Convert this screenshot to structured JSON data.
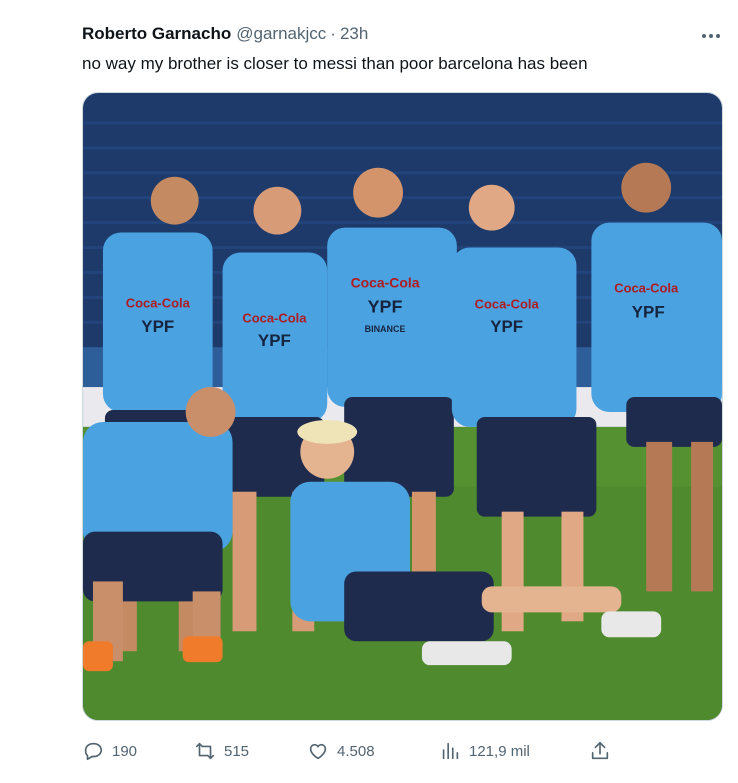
{
  "tweet": {
    "author_name": "Roberto Garnacho",
    "handle": "@garnakjcc",
    "separator": "·",
    "time": "23h",
    "text": "no way my brother is closer to messi than poor barcelona has been"
  },
  "media": {
    "jersey_sponsor_1": "Coca-Cola",
    "jersey_sponsor_2": "YPF",
    "jersey_sponsor_3": "BINANCE"
  },
  "actions": {
    "replies": "190",
    "reposts": "515",
    "likes": "4.508",
    "views": "121,9 mil"
  },
  "icons": {
    "more": "more-horizontal-icon",
    "reply": "reply-icon",
    "repost": "repost-icon",
    "like": "heart-icon",
    "views": "views-icon",
    "share": "share-icon"
  },
  "colors": {
    "text_primary": "#0f1419",
    "text_secondary": "#536471",
    "jersey_blue": "#4aa3e0",
    "shorts_navy": "#1f2b4d",
    "pitch_green": "#4f8a2e",
    "stadium_seats": "#1d3a6b"
  }
}
